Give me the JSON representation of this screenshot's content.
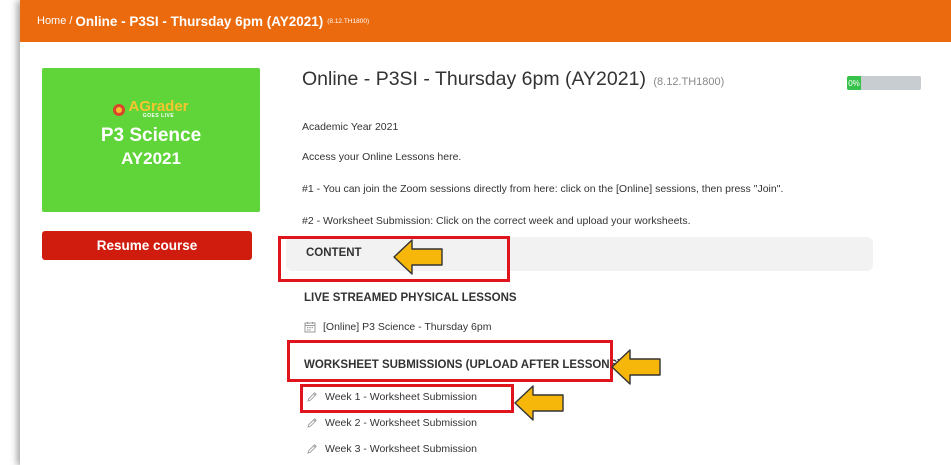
{
  "breadcrumb": {
    "home": "Home",
    "separator": "/",
    "current": "Online - P3SI - Thursday 6pm (AY2021)",
    "code": "(8.12.TH1800)"
  },
  "course_card": {
    "logo_text": "AGrader",
    "logo_subtext": "GOES LIVE",
    "title": "P3 Science",
    "subtitle": "AY2021",
    "background_color": "#5fd53a"
  },
  "resume_button": {
    "label": "Resume course",
    "color": "#d01c0f"
  },
  "course": {
    "title": "Online - P3SI - Thursday 6pm (AY2021)",
    "code": "(8.12.TH1800)",
    "progress_label": "0%",
    "progress_value": 0
  },
  "description": [
    "Academic Year 2021",
    "Access your Online Lessons here.",
    "#1 - You can join the Zoom sessions directly from here: click on the [Online] sessions, then press \"Join\".",
    "#2 - Worksheet Submission: Click on the correct week and upload your worksheets."
  ],
  "content_header": "CONTENT",
  "sections": [
    {
      "title": "LIVE STREAMED PHYSICAL LESSONS",
      "items": [
        {
          "icon": "calendar-icon",
          "label": "[Online] P3 Science - Thursday 6pm"
        }
      ]
    },
    {
      "title": "WORKSHEET SUBMISSIONS (UPLOAD AFTER LESSONS)",
      "items": [
        {
          "icon": "pencil-icon",
          "label": "Week 1 - Worksheet Submission"
        },
        {
          "icon": "pencil-icon",
          "label": "Week 2 - Worksheet Submission"
        },
        {
          "icon": "pencil-icon",
          "label": "Week 3 - Worksheet Submission"
        }
      ]
    }
  ],
  "colors": {
    "topbar": "#ea6a0d",
    "highlight": "#e0141c",
    "arrow": "#f6b70a"
  }
}
